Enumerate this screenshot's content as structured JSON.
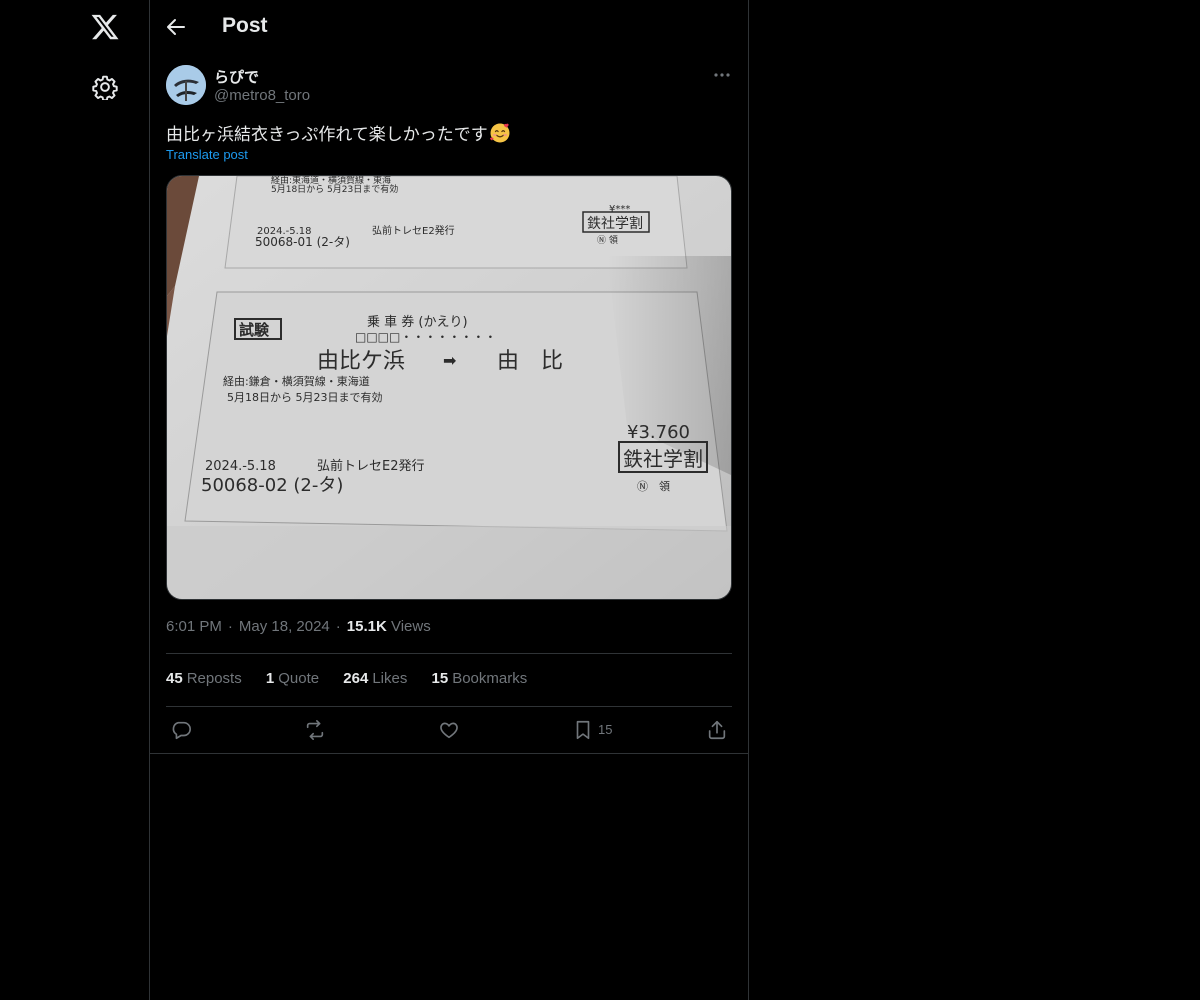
{
  "nav": {
    "logo_icon": "x-logo-icon",
    "settings_icon": "gear-icon"
  },
  "header": {
    "title": "Post",
    "back_icon": "arrow-left-icon"
  },
  "post": {
    "author": {
      "display_name": "らぴで",
      "handle": "@metro8_toro"
    },
    "text": "由比ヶ浜結衣きっぷ作れて楽しかったです",
    "emoji": "smiling-face-with-hearts",
    "translate_label": "Translate post",
    "media": {
      "ticket_top": {
        "route_line": "経由:東海道・横須賀線・東海",
        "validity": "5月18日から 5月23日まで有効",
        "date": "2024.-5.18",
        "issuer": "弘前トレセE2発行",
        "number": "50068-01 (2-タ)",
        "price": "¥***",
        "stamp": "鉄社学割",
        "stamp_sub": "Ⓝ 領"
      },
      "ticket_main": {
        "badge": "試験",
        "type": "乗 車 券 (かえり)",
        "dots": "□□□□・・・・・・・・",
        "from": "由比ケ浜",
        "arrow": "➡",
        "to": "由　比",
        "via": "経由:鎌倉・横須賀線・東海道",
        "validity": "5月18日から 5月23日まで有効",
        "price": "¥3.760",
        "stamp": "鉄社学割",
        "stamp_sub": "Ⓝ　領",
        "date": "2024.-5.18",
        "issuer": "弘前トレセE2発行",
        "number": "50068-02 (2-タ)"
      }
    },
    "time": "6:01 PM",
    "date": "May 18, 2024",
    "views_count": "15.1K",
    "views_label": "Views",
    "stats": {
      "reposts": {
        "count": "45",
        "label": "Reposts"
      },
      "quotes": {
        "count": "1",
        "label": "Quote"
      },
      "likes": {
        "count": "264",
        "label": "Likes"
      },
      "bookmarks": {
        "count": "15",
        "label": "Bookmarks"
      }
    },
    "actions": {
      "reply_icon": "reply-icon",
      "repost_icon": "repost-icon",
      "like_icon": "heart-icon",
      "bookmark_icon": "bookmark-icon",
      "bookmark_count": "15",
      "share_icon": "share-icon"
    },
    "more_icon": "more-icon"
  }
}
